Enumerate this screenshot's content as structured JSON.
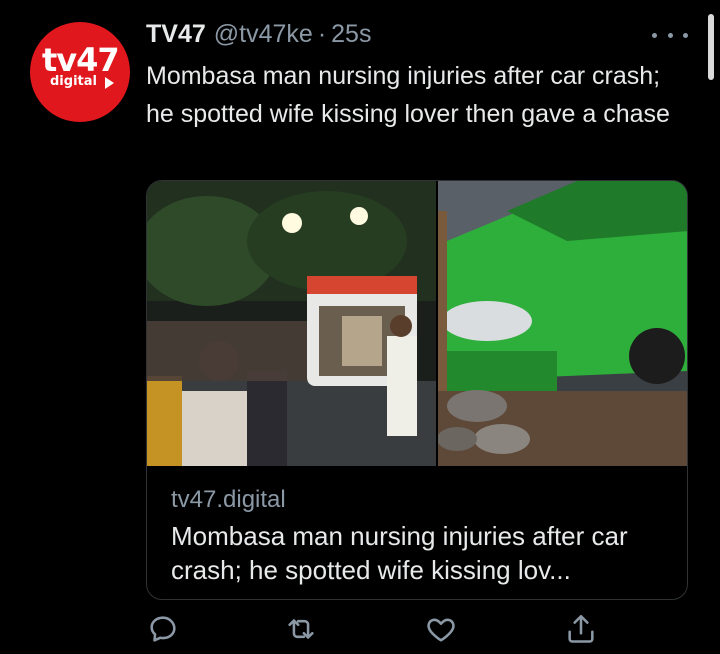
{
  "tweet": {
    "display_name": "TV47",
    "handle": "@tv47ke",
    "separator": "·",
    "timestamp": "25s",
    "text": "Mombasa man nursing injuries after car crash; he spotted wife kissing lover then gave a chase"
  },
  "avatar": {
    "logo_text": "tv47",
    "logo_subtext": "digital",
    "brand_color": "#e1171e"
  },
  "link_card": {
    "domain": "tv47.digital",
    "title": "Mombasa man nursing injuries after car crash; he spotted wife kissing lov..."
  },
  "actions": {
    "icons": [
      "reply-icon",
      "retweet-icon",
      "like-icon",
      "share-icon"
    ]
  },
  "colors": {
    "background": "#000000",
    "primary_text": "#e7e9ea",
    "secondary_text": "#8b98a5",
    "border": "#2f3336"
  }
}
